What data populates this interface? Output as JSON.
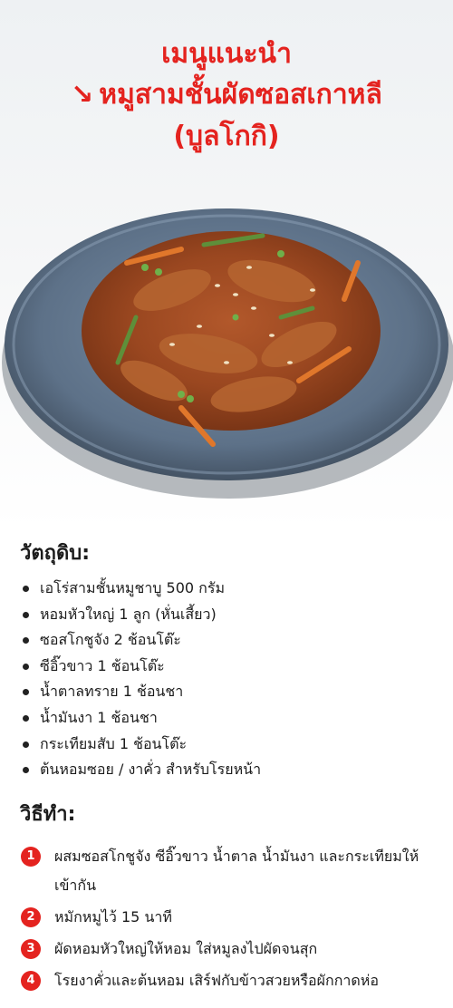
{
  "header": {
    "line1": "เมนูแนะนำ",
    "arrow": "↘",
    "line2": "หมูสามชั้นผัดซอสเกาหลี",
    "line3": "(บูลโกกิ)",
    "accent_color": "#e4231f"
  },
  "ingredients": {
    "title": "วัตถุดิบ:",
    "items": [
      "เอโร่สามชั้นหมูชาบู 500 กรัม",
      "หอมหัวใหญ่ 1 ลูก (หั่นเสี้ยว)",
      "ซอสโกชูจัง 2 ช้อนโต๊ะ",
      "ซีอิ๊วขาว 1 ช้อนโต๊ะ",
      "น้ำตาลทราย 1 ช้อนชา",
      "น้ำมันงา 1 ช้อนชา",
      "กระเทียมสับ 1 ช้อนโต๊ะ",
      "ต้นหอมซอย / งาคั่ว สำหรับโรยหน้า"
    ]
  },
  "method": {
    "title": "วิธีทำ:",
    "steps": [
      {
        "num": "1",
        "text": "ผสมซอสโกชูจัง ซีอิ๊วขาว น้ำตาล น้ำมันงา และกระเทียมให้เข้ากัน"
      },
      {
        "num": "2",
        "text": "หมักหมูไว้ 15 นาที"
      },
      {
        "num": "3",
        "text": "ผัดหอมหัวใหญ่ให้หอม ใส่หมูลงไปผัดจนสุก"
      },
      {
        "num": "4",
        "text": "โรยงาคั่วและต้นหอม เสิร์ฟกับข้าวสวยหรือผักกาดห่อ"
      }
    ]
  }
}
